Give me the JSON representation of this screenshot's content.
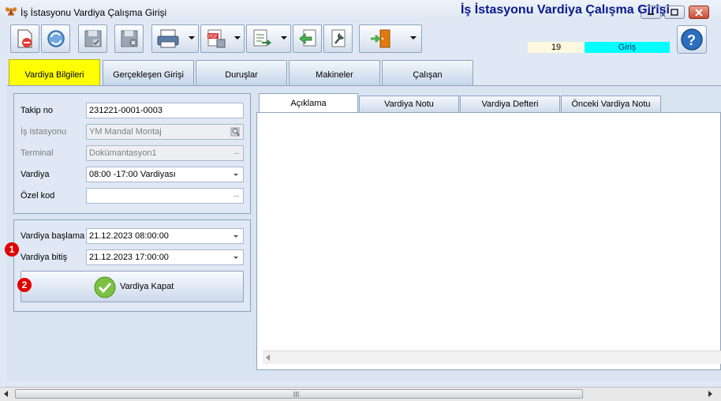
{
  "window": {
    "title": "İş İstasyonu Vardiya Çalışma Girişi"
  },
  "header": {
    "page_title": "İş İstasyonu Vardiya Çalışma Girişi",
    "status_number": "19",
    "status_label": "Giriş",
    "status_color": "#00ffff"
  },
  "toolbar": {
    "icons": [
      "new-document-icon",
      "refresh-icon",
      "save-icon",
      "delete-save-icon",
      "print-icon",
      "pdf-export-icon",
      "export-icon",
      "back-icon",
      "tools-icon",
      "exit-door-icon",
      "help-icon"
    ]
  },
  "main_tabs": [
    {
      "label": "Vardiya Bilgileri",
      "active": true
    },
    {
      "label": "Gerçekleşen Girişi"
    },
    {
      "label": "Duruşlar"
    },
    {
      "label": "Makineler"
    },
    {
      "label": "Çalışan"
    }
  ],
  "form": {
    "takip_no_label": "Takip no",
    "takip_no_value": "231221-0001-0003",
    "is_istasyonu_label": "İş istasyonu",
    "is_istasyonu_value": "YM Mandal Montaj",
    "terminal_label": "Terminal",
    "terminal_value": "Dokümantasyon1",
    "vardiya_label": "Vardiya",
    "vardiya_value": "08:00 -17:00 Vardiyası",
    "ozel_kod_label": "Özel kod",
    "ozel_kod_value": "",
    "baslama_label": "Vardiya başlama",
    "baslama_value": "21.12.2023 08:00:00",
    "bitis_label": "Vardiya bitiş",
    "bitis_value": "21.12.2023 17:00:00",
    "close_button_label": "Vardiya Kapat",
    "markers": [
      "1",
      "2"
    ]
  },
  "inner_tabs": [
    {
      "label": "Açıklama",
      "active": true
    },
    {
      "label": "Vardiya Notu"
    },
    {
      "label": "Vardiya Defteri"
    },
    {
      "label": "Önceki Vardiya Notu"
    }
  ],
  "colors": {
    "active_tab": "#ffff00",
    "marker": "#e00000",
    "title_text": "#0a1a8c"
  }
}
